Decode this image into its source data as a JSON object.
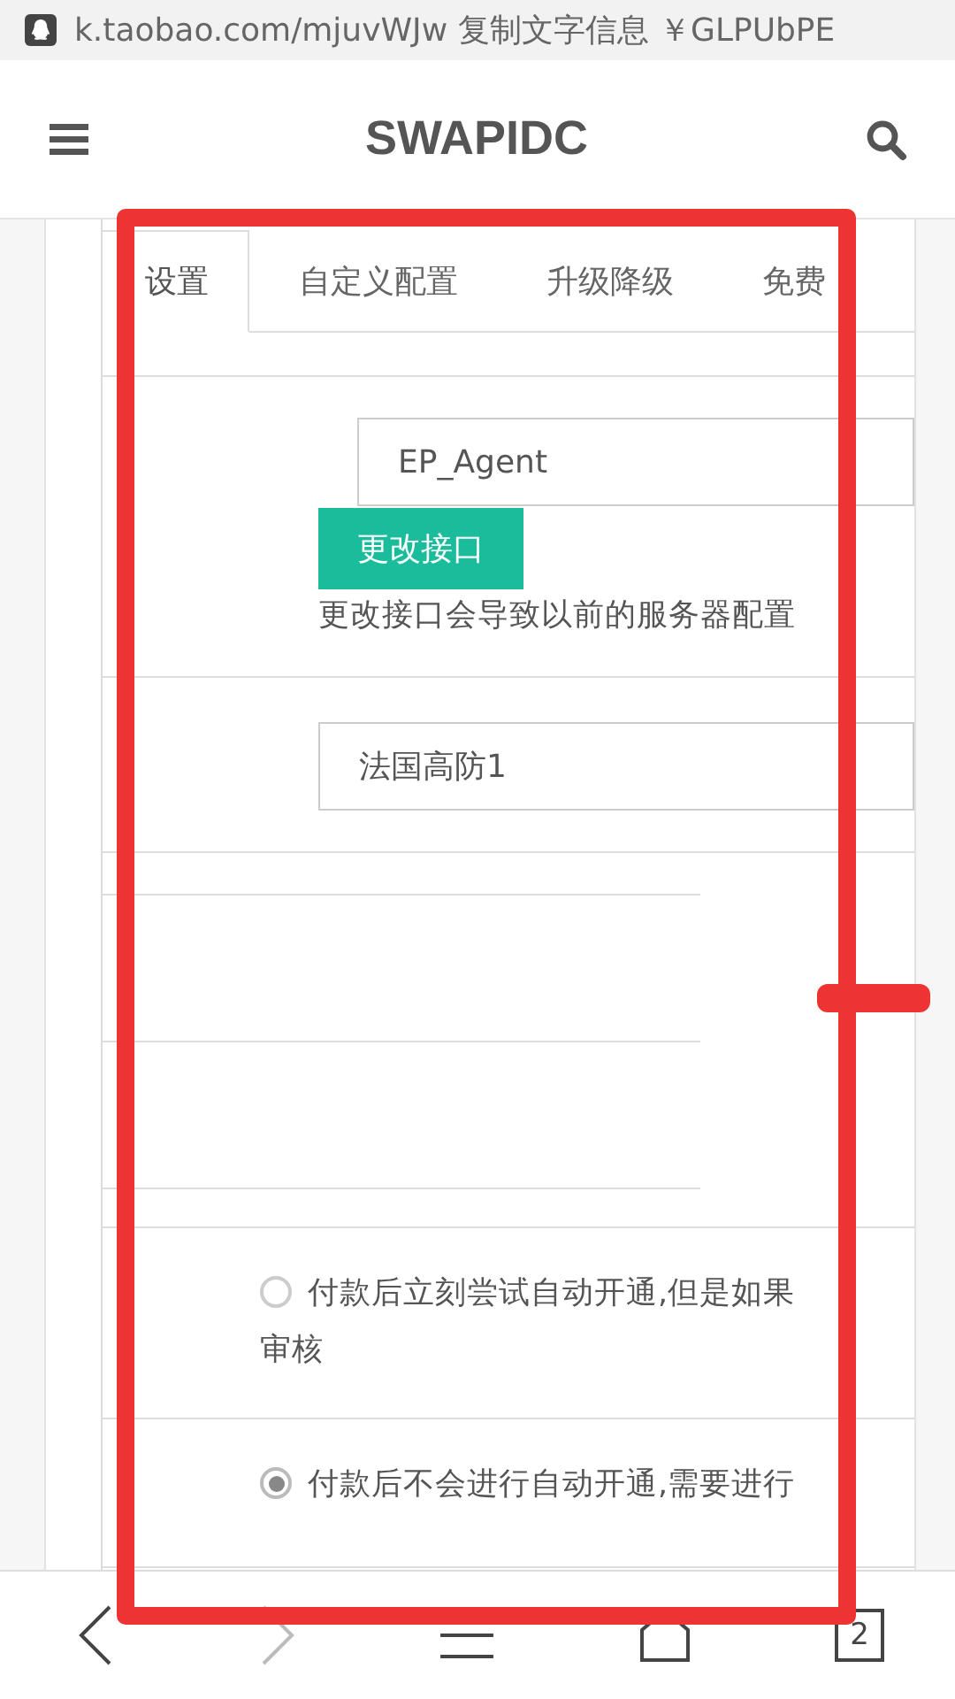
{
  "browser_bar": {
    "url": "k.taobao.com/mjuvWJw 复制文字信息 ￥GLPUbPE"
  },
  "header": {
    "title": "SWAPIDC"
  },
  "tabs": [
    {
      "label": "设置",
      "selected": true
    },
    {
      "label": "自定义配置",
      "selected": false
    },
    {
      "label": "升级降级",
      "selected": false
    },
    {
      "label": "免费",
      "selected": false
    }
  ],
  "interface": {
    "value": "EP_Agent",
    "button": "更改接口",
    "hint": "更改接口会导致以前的服务器配置"
  },
  "server": {
    "value": "法国高防1"
  },
  "activation_options": [
    {
      "label": "付款后立刻尝试自动开通,但是如果",
      "continuation": "审核",
      "selected": false
    },
    {
      "label": "付款后不会进行自动开通,需要进行",
      "selected": true
    }
  ],
  "nav_bar": {
    "tab_count": "2"
  }
}
